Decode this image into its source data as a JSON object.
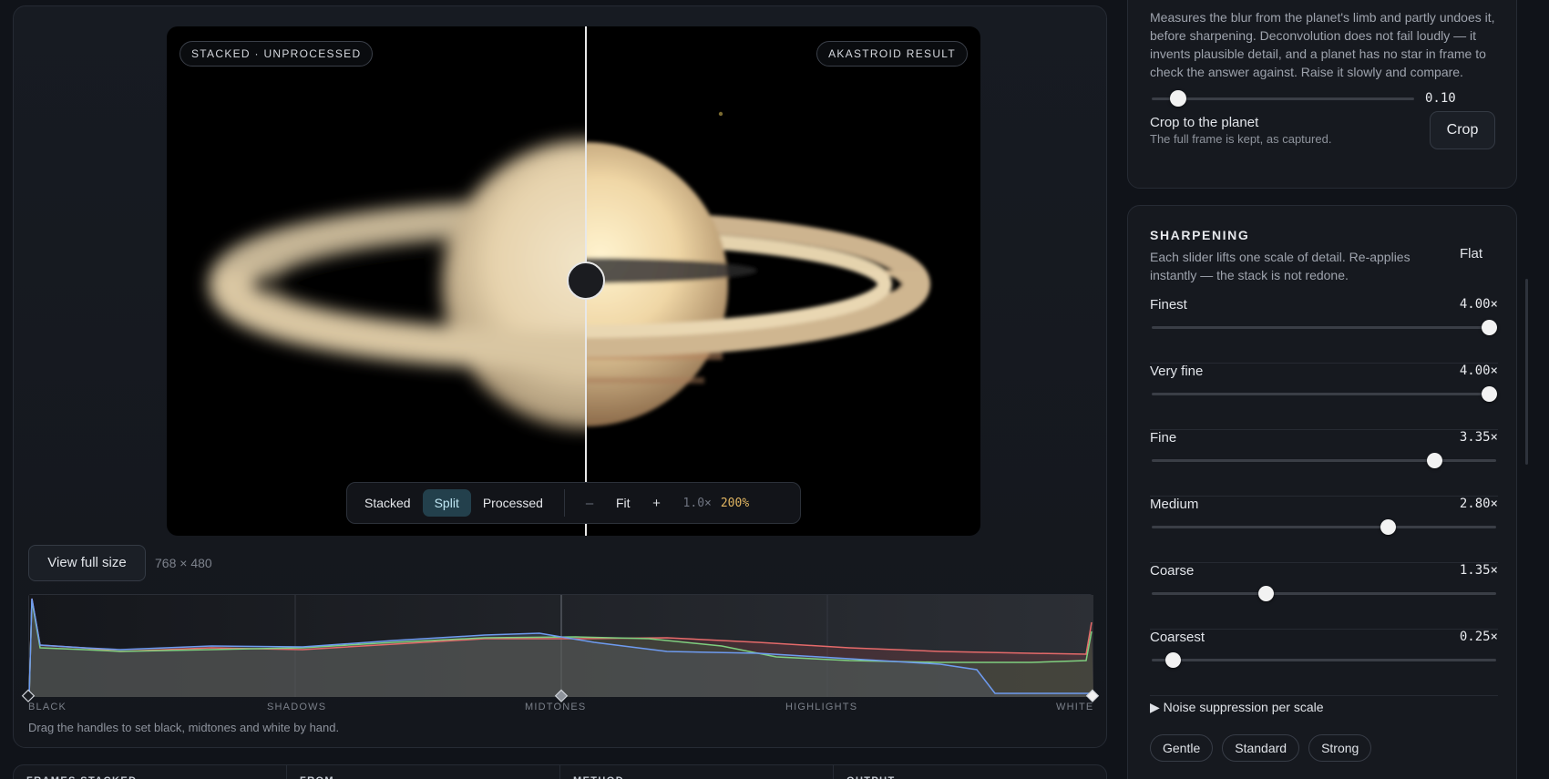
{
  "viewer": {
    "left_tag": "STACKED · UNPROCESSED",
    "right_tag": "AKASTROID RESULT",
    "modes": [
      "Stacked",
      "Split",
      "Processed"
    ],
    "active_mode": "Split",
    "zoom_out": "–",
    "zoom_fit": "Fit",
    "zoom_in": "+",
    "zoom_level": "1.0×",
    "zoom_percent": "200%",
    "split_position": 0.516
  },
  "output": {
    "view_full_size": "View full size",
    "dimensions": "768 × 480"
  },
  "histogram": {
    "labels": [
      "BLACK",
      "SHADOWS",
      "MIDTONES",
      "HIGHLIGHTS",
      "WHITE"
    ],
    "hint": "Drag the handles to set black, midtones and white by hand.",
    "handles": {
      "black": 0.0,
      "midtones": 0.5,
      "white": 1.0
    },
    "colors": {
      "red": "#e56a6a",
      "green": "#7fd07f",
      "blue": "#6e9bf0"
    }
  },
  "stats_strip": [
    "FRAMES STACKED",
    "FROM",
    "METHOD",
    "OUTPUT"
  ],
  "deconvolution": {
    "description": "Measures the blur from the planet's limb and partly undoes it, before sharpening. Deconvolution does not fail loudly — it invents plausible detail, and a planet has no star in frame to check the answer against. Raise it slowly and compare.",
    "value_label": "0.10",
    "value": 0.1,
    "max": 1.0
  },
  "crop": {
    "title": "Crop to the planet",
    "subtitle": "The full frame is kept, as captured.",
    "button": "Crop"
  },
  "sharpening": {
    "heading": "SHARPENING",
    "description": "Each slider lifts one scale of detail. Re-applies instantly — the stack is not redone.",
    "flat_button": "Flat",
    "max": 4.0,
    "scales": [
      {
        "name": "Finest",
        "value_label": "4.00×",
        "value": 4.0
      },
      {
        "name": "Very fine",
        "value_label": "4.00×",
        "value": 4.0
      },
      {
        "name": "Fine",
        "value_label": "3.35×",
        "value": 3.35
      },
      {
        "name": "Medium",
        "value_label": "2.80×",
        "value": 2.8
      },
      {
        "name": "Coarse",
        "value_label": "1.35×",
        "value": 1.35
      },
      {
        "name": "Coarsest",
        "value_label": "0.25×",
        "value": 0.25
      }
    ],
    "noise_toggle": "▶ Noise suppression per scale",
    "presets": [
      "Gentle",
      "Standard",
      "Strong"
    ]
  }
}
